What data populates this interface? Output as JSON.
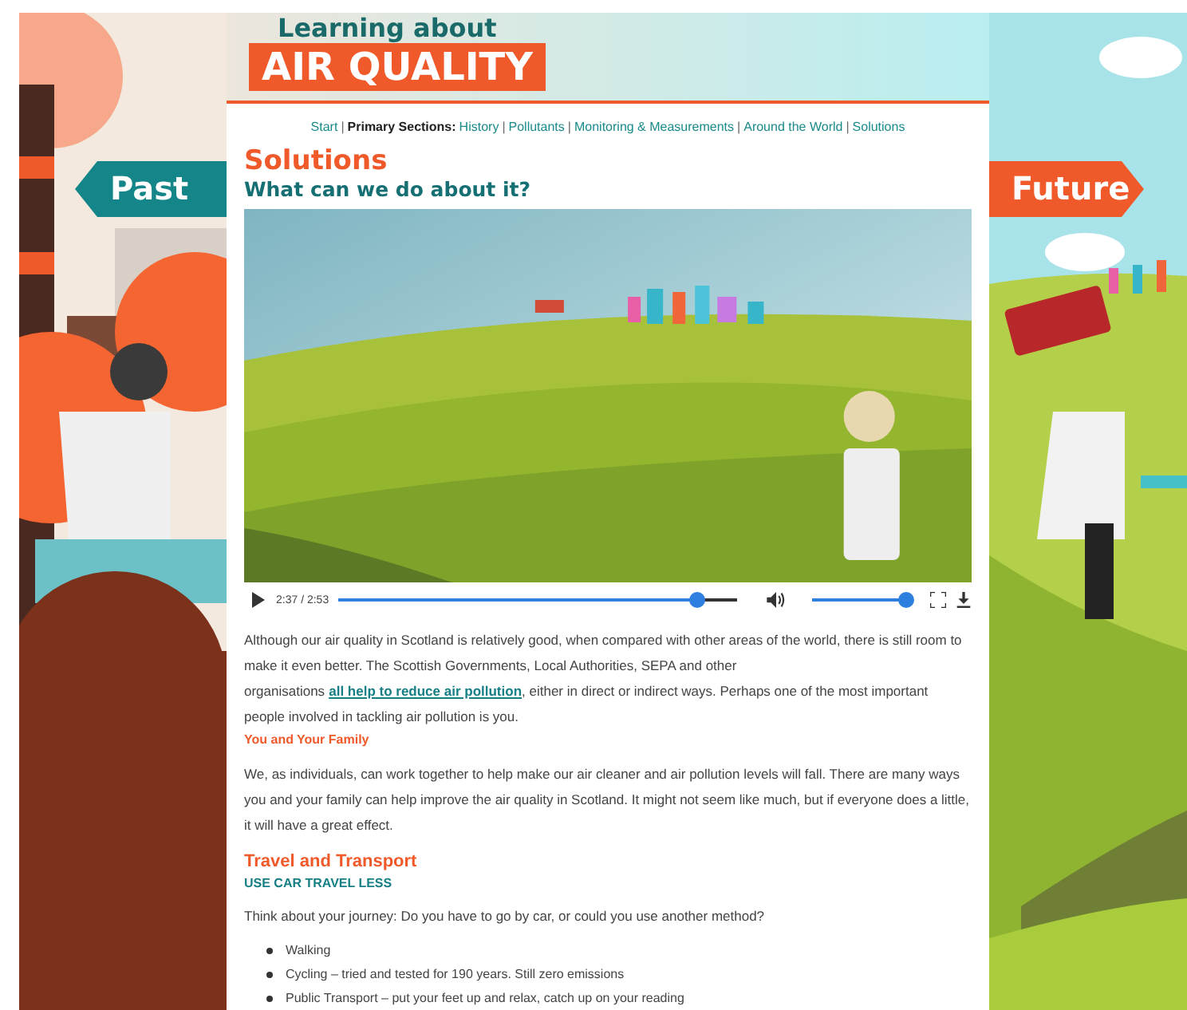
{
  "logo": {
    "line1": "Learning about",
    "line2": "AIR QUALITY"
  },
  "side_signs": [
    {
      "label": "Past",
      "kind": "left"
    },
    {
      "label": "Future",
      "kind": "right"
    }
  ],
  "nav": [
    {
      "label": "Start",
      "kind": "link"
    },
    {
      "label": "|",
      "kind": "separator"
    },
    {
      "label": "Primary Sections:",
      "kind": "label"
    },
    {
      "label": "History",
      "kind": "link"
    },
    {
      "label": "|",
      "kind": "separator"
    },
    {
      "label": "Pollutants",
      "kind": "link"
    },
    {
      "label": "|",
      "kind": "separator"
    },
    {
      "label": "Monitoring & Measurements",
      "kind": "link"
    },
    {
      "label": "|",
      "kind": "separator"
    },
    {
      "label": "Around the World",
      "kind": "link"
    },
    {
      "label": "|",
      "kind": "separator"
    },
    {
      "label": "Solutions",
      "kind": "link"
    }
  ],
  "heading": "Solutions",
  "subheading": "What can we do about it?",
  "video": {
    "time": "2:37 / 2:53",
    "progress": {
      "level": 0.9
    },
    "volume": {
      "level": 0.95
    }
  },
  "content": [
    {
      "kind": "paragraph",
      "text": "Although our air quality in Scotland is relatively good, when compared with other areas of the world, there is still room to make it even better. The Scottish Governments, Local Authorities, SEPA and other organisations",
      "link": "all help to reduce air pollution",
      "after": ", either in direct or indirect ways. Perhaps one of the most important people involved in tackling air pollution is you."
    },
    {
      "kind": "subhead",
      "text": "You and Your Family"
    },
    {
      "kind": "paragraph",
      "text": "We, as individuals, can work together to help make our air cleaner and air pollution levels will fall. There are many ways you and your family can help improve the air quality in Scotland. It might not seem like much, but if everyone does a little, it will have a great effect."
    },
    {
      "kind": "heading",
      "text": "Travel and Transport"
    },
    {
      "kind": "caps",
      "text": "USE CAR TRAVEL LESS"
    },
    {
      "kind": "paragraph",
      "text": "Think about your journey: Do you have to go by car, or could you use another method?"
    },
    {
      "kind": "bullets",
      "items": [
        "Walking",
        "Cycling – tried and tested for 190 years. Still zero emissions",
        "Public Transport – put your feet up and relax, catch up on your reading"
      ]
    }
  ]
}
